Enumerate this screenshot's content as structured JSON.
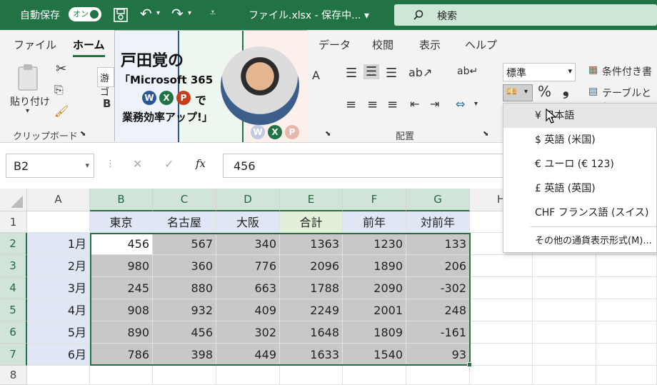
{
  "titlebar": {
    "autosave_label": "自動保存",
    "toggle_label": "オン",
    "file_title": "ファイル.xlsx - 保存中... ▾",
    "search_label": "検索"
  },
  "menus": [
    "ファイル",
    "ホーム",
    "データ",
    "校閲",
    "表示",
    "ヘルプ"
  ],
  "ribbon": {
    "paste_label": "貼り付け",
    "clipboard_label": "クリップボード",
    "font_partial": "游ゴ",
    "bold_label": "B",
    "align_label": "配置",
    "number_format_value": "標準",
    "percent_label": "%",
    "comma_label": "❟",
    "conditional_label": "条件付き書",
    "table_label": "テーブルとし",
    "font_size_btn": "A"
  },
  "overlay": {
    "name": "戸田覚の",
    "line2": "「Microsoft 365",
    "line3_suffix": "で",
    "line4": "業務効率アップ!」",
    "badges": [
      "W",
      "X",
      "P"
    ],
    "brand_colors": {
      "W": "#2b5797",
      "X": "#217346",
      "P": "#c43e1c"
    }
  },
  "formula": {
    "name_box": "B2",
    "fx_label": "fx",
    "value": "456"
  },
  "columns": [
    "A",
    "B",
    "C",
    "D",
    "E",
    "F",
    "G",
    "H"
  ],
  "rows": [
    "1",
    "2",
    "3",
    "4",
    "5",
    "6",
    "7",
    "8"
  ],
  "table": {
    "headers": [
      "東京",
      "名古屋",
      "大阪",
      "合計",
      "前年",
      "対前年"
    ],
    "months": [
      "1月",
      "2月",
      "3月",
      "4月",
      "5月",
      "6月"
    ],
    "values": [
      [
        "456",
        "567",
        "340",
        "1363",
        "1230",
        "133"
      ],
      [
        "980",
        "360",
        "776",
        "2096",
        "1890",
        "206"
      ],
      [
        "245",
        "880",
        "663",
        "1788",
        "2090",
        "-302"
      ],
      [
        "908",
        "932",
        "409",
        "2249",
        "2001",
        "248"
      ],
      [
        "890",
        "456",
        "302",
        "1648",
        "1809",
        "-161"
      ],
      [
        "786",
        "398",
        "449",
        "1633",
        "1540",
        "93"
      ]
    ]
  },
  "currency_menu": [
    "¥ 日本語",
    "$ 英語 (米国)",
    "€ ユーロ (€ 123)",
    "£ 英語 (英国)",
    "CHF フランス語 (スイス)",
    "その他の通貨表示形式(M)..."
  ],
  "colors": {
    "accent": "#217346",
    "selection": "#c8c8c8",
    "header_fill": "#dfe7f4",
    "total_fill": "#e2f0d9"
  }
}
